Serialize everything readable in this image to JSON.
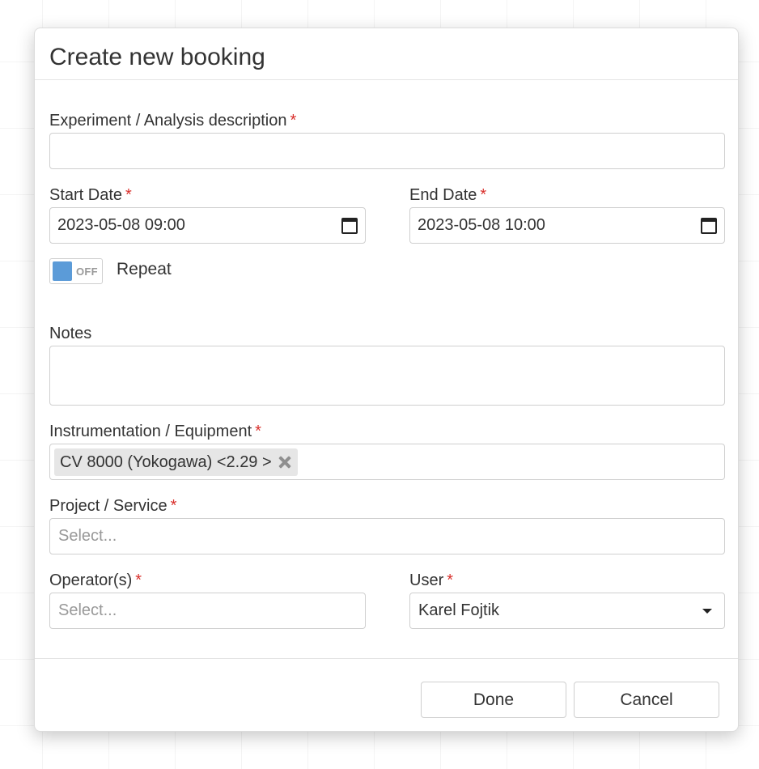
{
  "dialog": {
    "title": "Create new booking"
  },
  "form": {
    "description": {
      "label": "Experiment / Analysis description",
      "required_mark": "*",
      "value": ""
    },
    "start_date": {
      "label": "Start Date",
      "required_mark": "*",
      "value": "2023-05-08 09:00",
      "icon": "calendar-icon"
    },
    "end_date": {
      "label": "End Date",
      "required_mark": "*",
      "value": "2023-05-08 10:00",
      "icon": "calendar-icon"
    },
    "repeat": {
      "toggle_state": "OFF",
      "label": "Repeat"
    },
    "notes": {
      "label": "Notes",
      "value": ""
    },
    "instrumentation": {
      "label": "Instrumentation / Equipment",
      "required_mark": "*",
      "selected_tags": [
        "CV 8000 (Yokogawa) <2.29 >"
      ]
    },
    "project": {
      "label": "Project / Service",
      "required_mark": "*",
      "placeholder": "Select..."
    },
    "operators": {
      "label": "Operator(s)",
      "required_mark": "*",
      "placeholder": "Select..."
    },
    "user": {
      "label": "User",
      "required_mark": "*",
      "value": "Karel Fojtik"
    }
  },
  "buttons": {
    "done": "Done",
    "cancel": "Cancel"
  },
  "colors": {
    "required": "#d9302c",
    "toggle_knob": "#5b9bd8"
  }
}
